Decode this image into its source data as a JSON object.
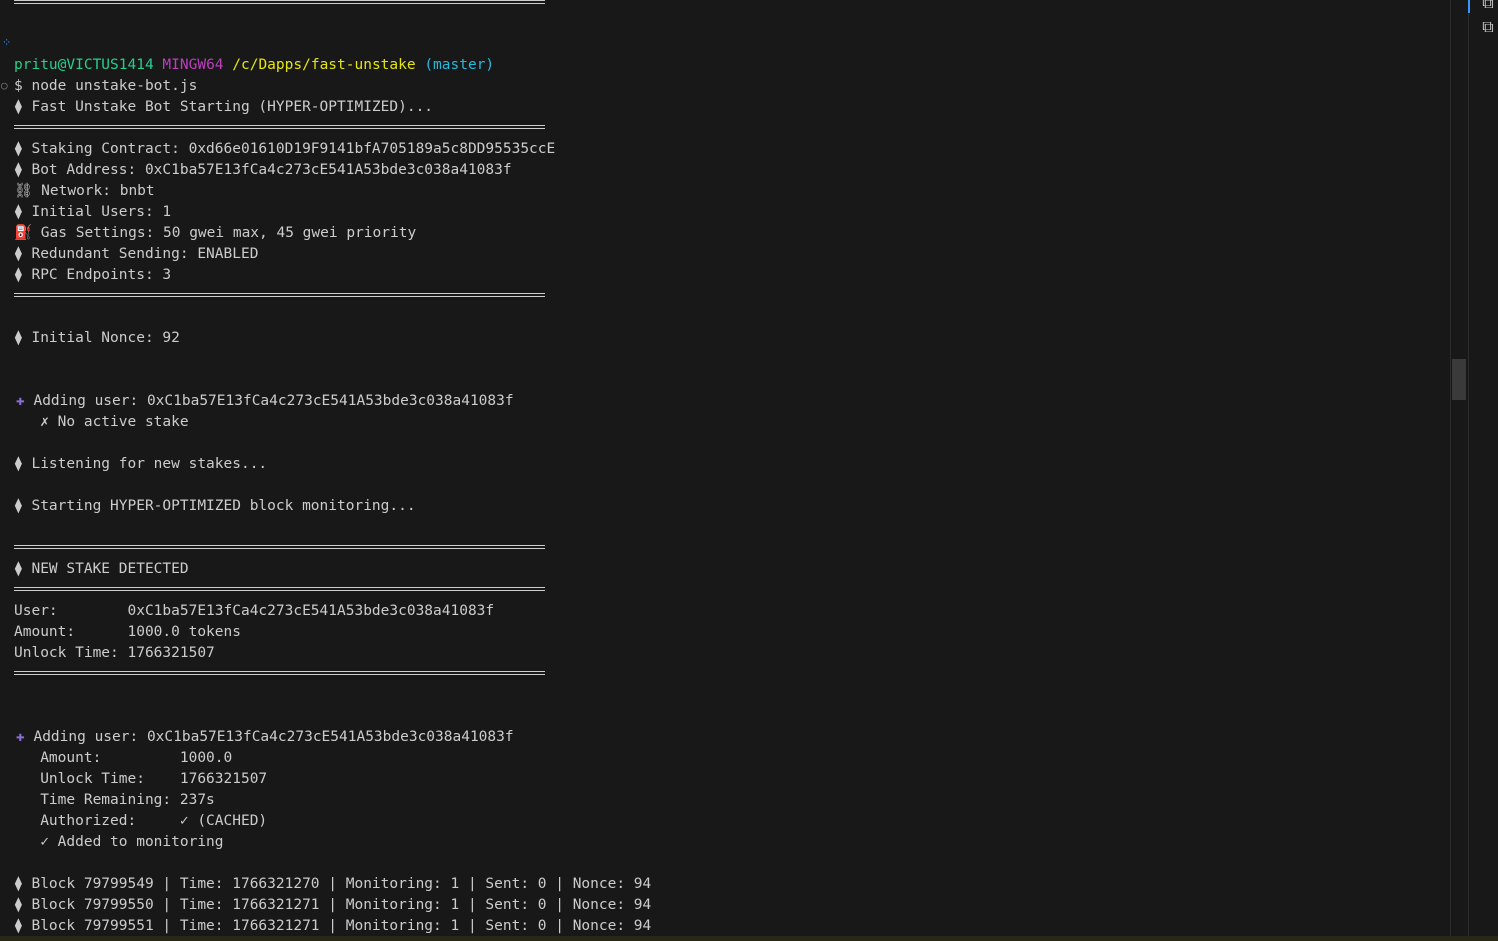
{
  "prompt": {
    "user_host": "pritu@VICTUS1414",
    "shell": "MINGW64",
    "cwd": "/c/Dapps/fast-unstake",
    "branch": "(master)",
    "command": "$ node unstake-bot.js"
  },
  "header": {
    "starting": "⧫ Fast Unstake Bot Starting (HYPER-OPTIMIZED)..."
  },
  "config": {
    "staking_contract": "⧫ Staking Contract: 0xd66e01610D19F9141bfA705189a5c8DD95535ccE",
    "bot_address": "⧫ Bot Address: 0xC1ba57E13fCa4c273cE541A53bde3c038a41083f",
    "network_icon": "⛓",
    "network": " Network: bnbt",
    "initial_users": "⧫ Initial Users: 1",
    "gas_icon": "⛽",
    "gas": " Gas Settings: 50 gwei max, 45 gwei priority",
    "redundant": "⧫ Redundant Sending: ENABLED",
    "rpc": "⧫ RPC Endpoints: 3"
  },
  "nonce": "⧫ Initial Nonce: 92",
  "first_add": {
    "plus_icon": "✚",
    "text": " Adding user: 0xC1ba57E13fCa4c273cE541A53bde3c038a41083f",
    "status": "   ✗ No active stake"
  },
  "listening": "⧫ Listening for new stakes...",
  "monitoring": "⧫ Starting HYPER-OPTIMIZED block monitoring...",
  "detected": {
    "title": "⧫ NEW STAKE DETECTED",
    "user": "User:        0xC1ba57E13fCa4c273cE541A53bde3c038a41083f",
    "amount": "Amount:      1000.0 tokens",
    "unlock": "Unlock Time: 1766321507"
  },
  "second_add": {
    "plus_icon": "✚",
    "text": " Adding user: 0xC1ba57E13fCa4c273cE541A53bde3c038a41083f",
    "amount": "   Amount:         1000.0",
    "unlock": "   Unlock Time:    1766321507",
    "remaining": "   Time Remaining: 237s",
    "authorized": "   Authorized:     ✓ (CACHED)",
    "added": "   ✓ Added to monitoring"
  },
  "blocks": [
    "⧫ Block 79799549 | Time: 1766321270 | Monitoring: 1 | Sent: 0 | Nonce: 94",
    "⧫ Block 79799550 | Time: 1766321271 | Monitoring: 1 | Sent: 0 | Nonce: 94",
    "⧫ Block 79799551 | Time: 1766321271 | Monitoring: 1 | Sent: 0 | Nonce: 94"
  ],
  "icons": {
    "gutter_top": "sparkle-icon",
    "gutter_cmd": "circle-icon",
    "panel_top": "terminal-split-icon",
    "panel_second": "terminal-tab-icon"
  },
  "colors": {
    "background": "#181818",
    "text": "#cccccc",
    "user_host": "#23d18b",
    "shell": "#bc3fbc",
    "cwd": "#e5e510",
    "branch": "#29b8db",
    "plus": "#8a70d6"
  }
}
